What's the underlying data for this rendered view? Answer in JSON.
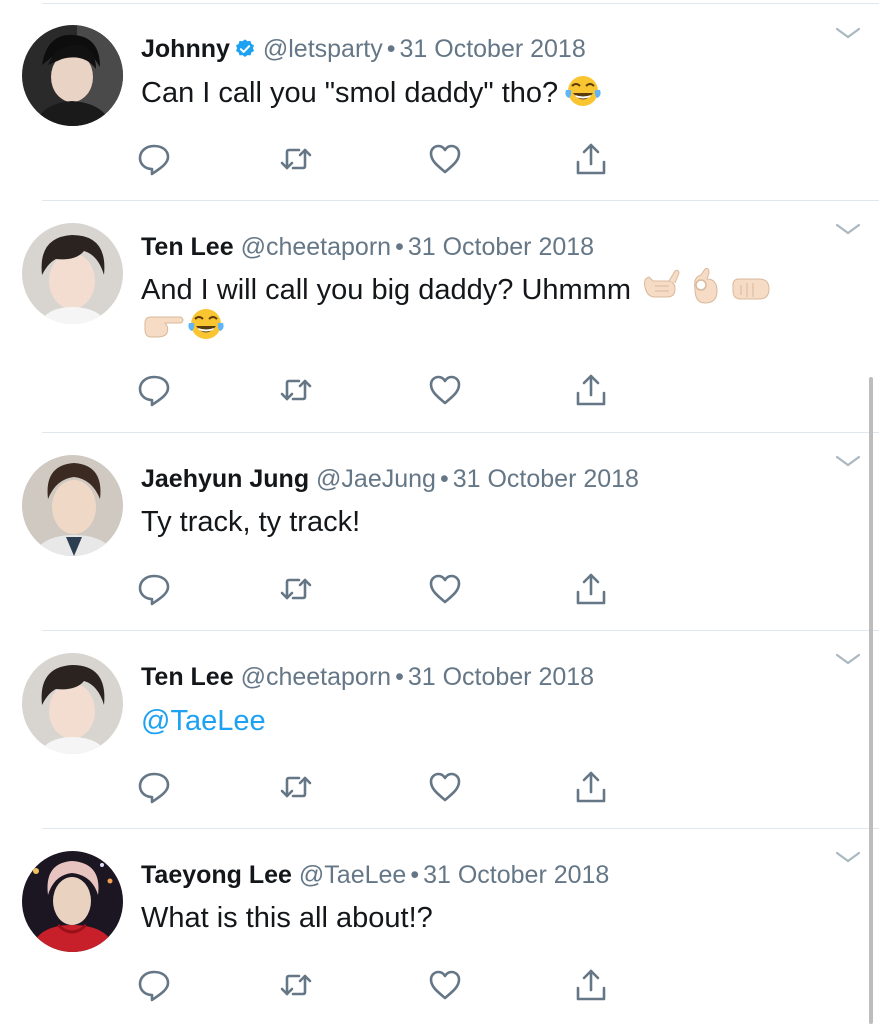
{
  "colors": {
    "text": "#14171a",
    "secondary": "#657786",
    "link": "#1da1f2",
    "divider": "#e1e8ed",
    "verified": "#1da1f2"
  },
  "icons": {
    "reply": "reply-icon",
    "retweet": "retweet-icon",
    "like": "like-icon",
    "share": "share-icon",
    "more": "chevron-down-icon",
    "verified": "verified-badge-icon"
  },
  "tweets": [
    {
      "name": "Johnny",
      "verified": true,
      "handle": "@letsparty",
      "separator": "•",
      "date": "31 October 2018",
      "lines": [
        "Can I call you \"smol daddy\" tho?"
      ],
      "emojis": [
        "face-with-tears-of-joy"
      ]
    },
    {
      "name": "Ten Lee",
      "verified": false,
      "handle": "@cheetaporn",
      "separator": "•",
      "date": "31 October 2018",
      "lines": [
        "And I will call you big daddy? Uhmmm"
      ],
      "emojis": [
        "call-me-hand",
        "ok-hand",
        "left-facing-fist",
        "backhand-index-pointing-right",
        "face-with-tears-of-joy"
      ]
    },
    {
      "name": "Jaehyun Jung",
      "verified": false,
      "handle": "@JaeJung",
      "separator": "•",
      "date": "31 October 2018",
      "lines": [
        "Ty track, ty track!"
      ],
      "emojis": []
    },
    {
      "name": "Ten Lee",
      "verified": false,
      "handle": "@cheetaporn",
      "separator": "•",
      "date": "31 October 2018",
      "lines": [
        "@TaeLee"
      ],
      "emojis": []
    },
    {
      "name": "Taeyong Lee",
      "verified": false,
      "handle": "@TaeLee",
      "separator": "•",
      "date": "31 October 2018",
      "lines": [
        "What is this all about!?"
      ],
      "emojis": []
    }
  ]
}
